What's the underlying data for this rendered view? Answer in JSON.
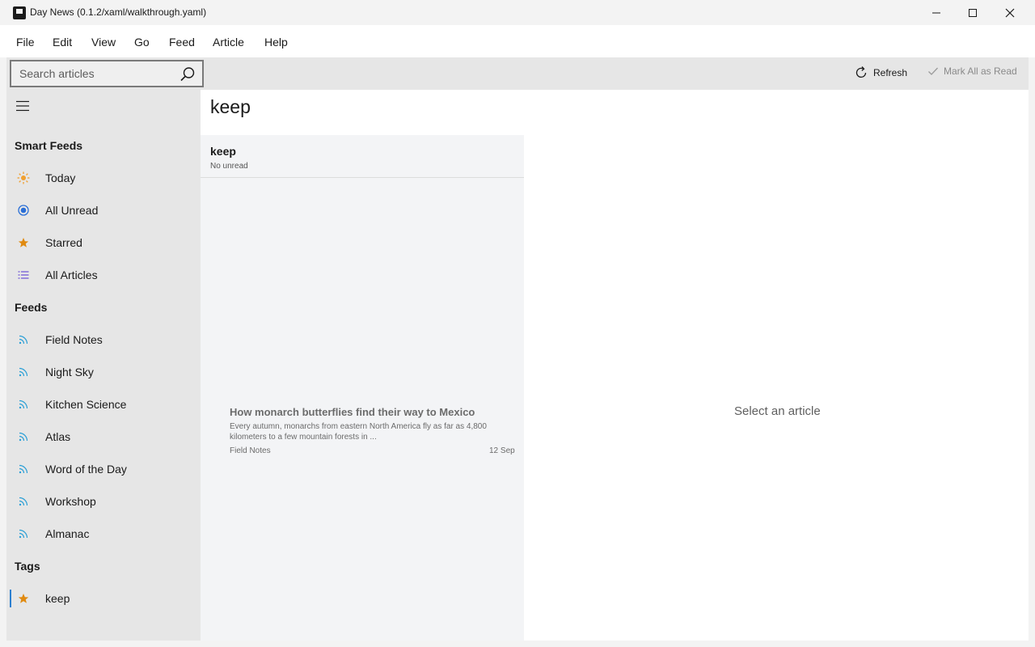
{
  "window": {
    "title": "Day News (0.1.2/xaml/walkthrough.yaml)"
  },
  "menu": [
    "File",
    "Edit",
    "View",
    "Go",
    "Feed",
    "Article",
    "Help"
  ],
  "toolbar": {
    "search_placeholder": "Search articles",
    "refresh_label": "Refresh",
    "mark_all_read_label": "Mark All as Read"
  },
  "sidebar": {
    "smart_feeds_heading": "Smart Feeds",
    "smart_feeds": [
      {
        "label": "Today",
        "icon": "sun-icon",
        "color": "#f0a030"
      },
      {
        "label": "All Unread",
        "icon": "radio-dot-icon",
        "color": "#2b6fd6"
      },
      {
        "label": "Starred",
        "icon": "star-icon",
        "color": "#e08a10"
      },
      {
        "label": "All Articles",
        "icon": "list-icon",
        "color": "#6a4fd6"
      }
    ],
    "feeds_heading": "Feeds",
    "feeds": [
      {
        "label": "Field Notes",
        "icon": "rss-icon",
        "color": "#2a9fd6"
      },
      {
        "label": "Night Sky",
        "icon": "rss-icon",
        "color": "#2a9fd6"
      },
      {
        "label": "Kitchen Science",
        "icon": "rss-icon",
        "color": "#2a9fd6"
      },
      {
        "label": "Atlas",
        "icon": "rss-icon",
        "color": "#2a9fd6"
      },
      {
        "label": "Word of the Day",
        "icon": "rss-icon",
        "color": "#2a9fd6"
      },
      {
        "label": "Workshop",
        "icon": "rss-icon",
        "color": "#2a9fd6"
      },
      {
        "label": "Almanac",
        "icon": "rss-icon",
        "color": "#2a9fd6"
      }
    ],
    "tags_heading": "Tags",
    "tags": [
      {
        "label": "keep",
        "icon": "star-icon",
        "color": "#e08a10"
      }
    ]
  },
  "main": {
    "page_title": "keep",
    "list_header": {
      "title": "keep",
      "subtitle": "No unread"
    },
    "articles": [
      {
        "title": "How monarch butterflies find their way to Mexico",
        "snippet": "Every autumn, monarchs from eastern North America fly as far as 4,800 kilometers to a few mountain forests in ...",
        "feed": "Field Notes",
        "date": "12 Sep"
      }
    ],
    "reader_empty": "Select an article"
  }
}
